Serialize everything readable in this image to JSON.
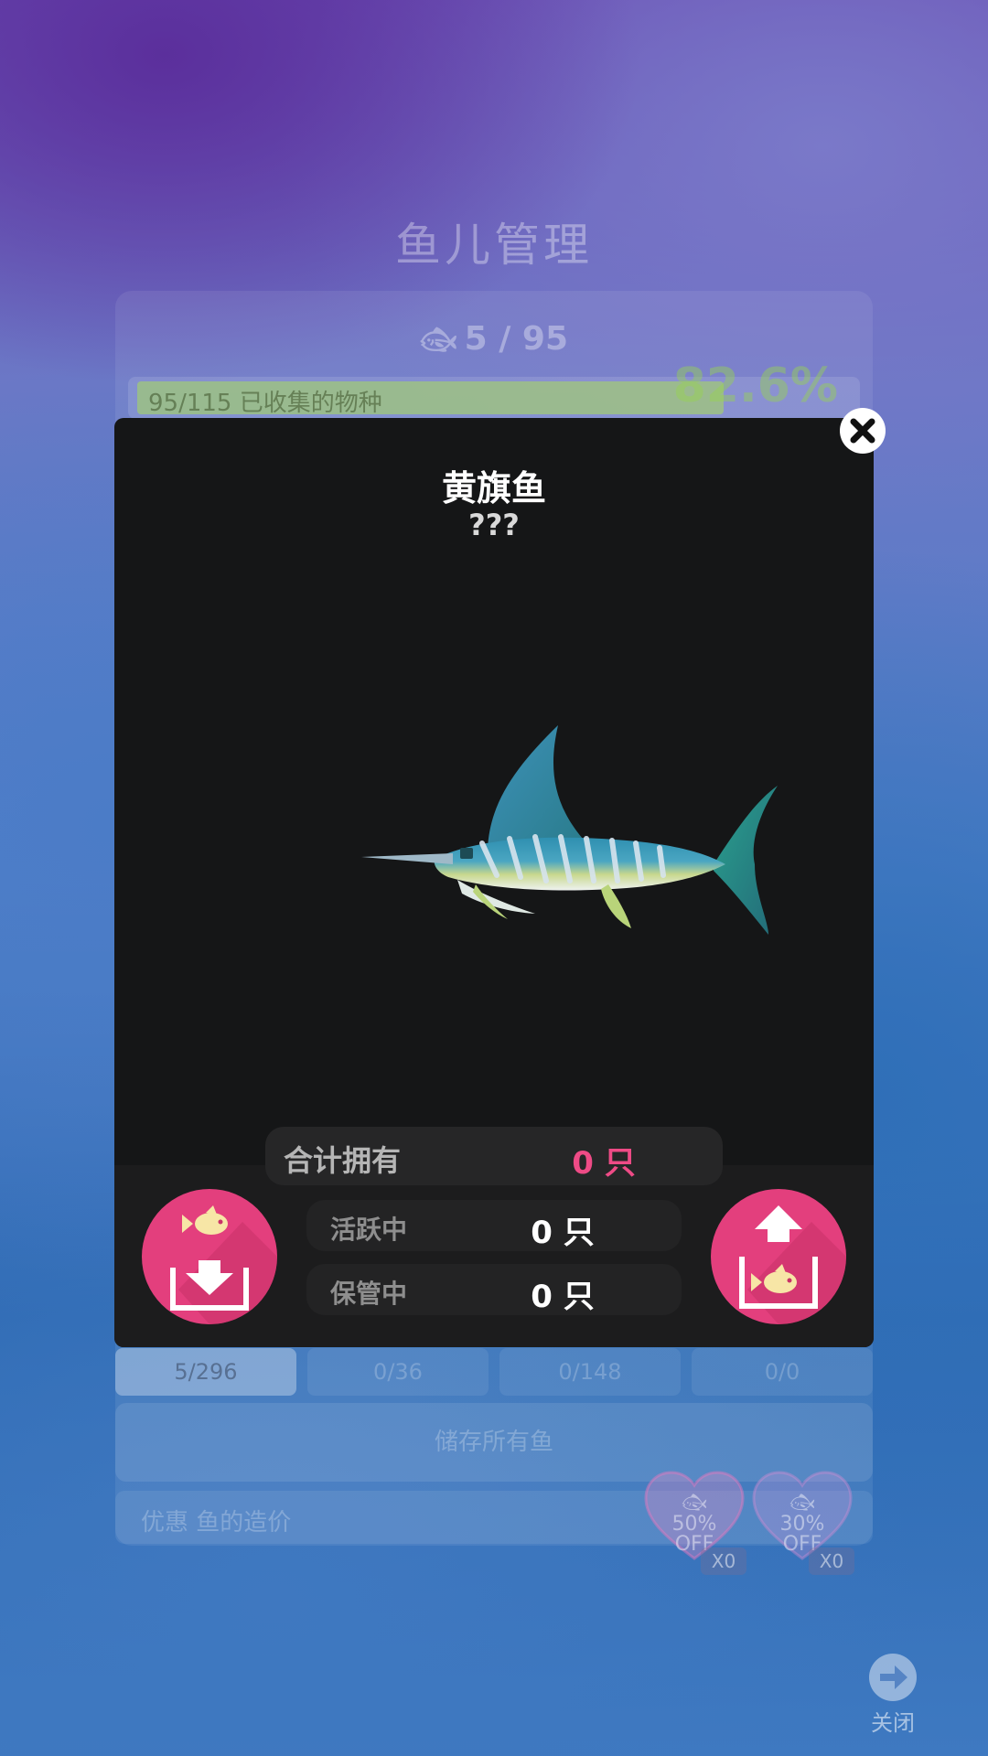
{
  "background": {
    "title": "鱼儿管理",
    "fish_count": "5 / 95",
    "collection_label": "95/115 已收集的物种",
    "collection_percent": "82.6%",
    "collection_progress": 0.826,
    "tabs": [
      {
        "label": "5/296",
        "active": true
      },
      {
        "label": "0/36",
        "active": false
      },
      {
        "label": "0/148",
        "active": false
      },
      {
        "label": "0/0",
        "active": false
      }
    ],
    "store_all_label": "储存所有鱼",
    "discount_label": "优惠 鱼的造价",
    "coupons": [
      {
        "line1": "50%",
        "line2": "OFF",
        "count": "X0"
      },
      {
        "line1": "30%",
        "line2": "OFF",
        "count": "X0"
      }
    ],
    "close_label": "关闭"
  },
  "modal": {
    "fish_name": "黄旗鱼",
    "fish_subtitle": "???",
    "fish_icon": "marlin",
    "total_label": "合计拥有",
    "total_value": "0 只",
    "active_label": "活跃中",
    "active_value": "0 只",
    "stored_label": "保管中",
    "stored_value": "0 只",
    "store_button_icon": "fish-into-box-icon",
    "release_button_icon": "fish-out-of-box-icon",
    "close_icon": "close-icon"
  },
  "colors": {
    "accent_pink": "#e33f7d",
    "total_value": "#ee4b86",
    "progress_green": "#a8d95a",
    "modal_bg": "#151617"
  }
}
